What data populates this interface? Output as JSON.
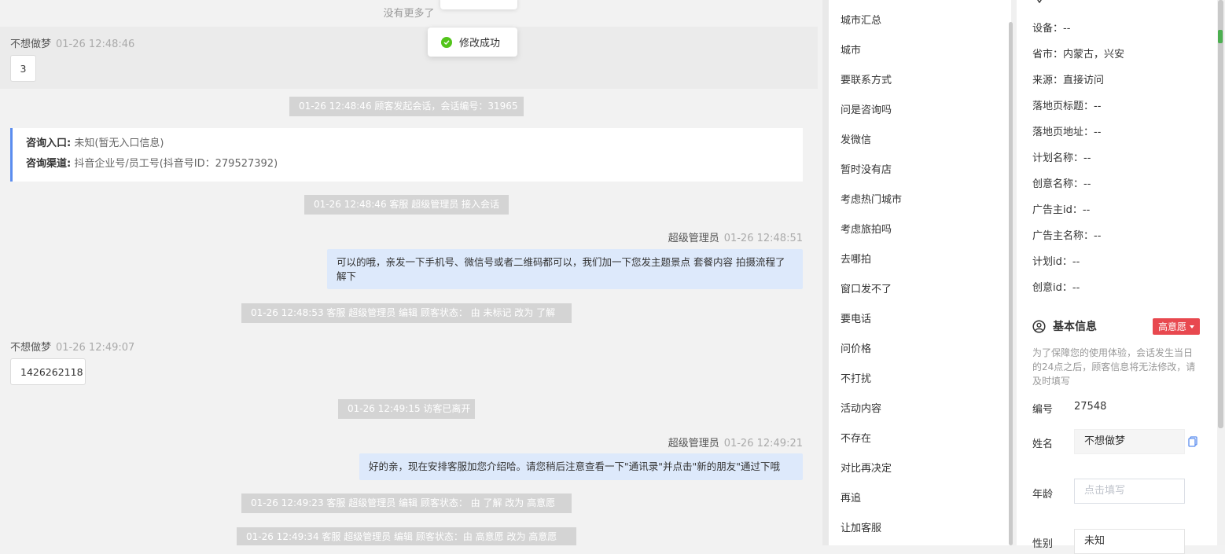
{
  "chat": {
    "no_more": "没有更多了",
    "toast": "修改成功",
    "messages": {
      "m1_sender": "不想做梦",
      "m1_time": "01-26 12:48:46",
      "m1_text": "3",
      "sys1": "01-26 12:48:46 顾客发起会话，会话编号：31965",
      "consult_entry_label": "咨询入口:",
      "consult_entry_value": "未知(暂无入口信息)",
      "consult_channel_label": "咨询渠道:",
      "consult_channel_value": "抖音企业号/员工号(抖音号ID：279527392)",
      "sys2": "01-26 12:48:46 客服 超级管理员 接入会话",
      "m2_sender": "超级管理员",
      "m2_time": "01-26 12:48:51",
      "m2_text": "可以的哦，亲发一下手机号、微信号或者二维码都可以，我们加一下您发主题景点 套餐内容 拍摄流程了解下",
      "sys3": "01-26 12:48:53 客服 超级管理员 编辑 顾客状态： 由 未标记 改为 了解",
      "m3_sender": "不想做梦",
      "m3_time": "01-26 12:49:07",
      "m3_text": "1426262118",
      "sys4": "01-26 12:49:15 访客已离开",
      "m4_sender": "超级管理员",
      "m4_time": "01-26 12:49:21",
      "m4_text": "好的亲，现在安排客服加您介绍哈。请您稍后注意查看一下\"通讯录\"并点击\"新的朋友\"通过下哦",
      "sys5": "01-26 12:49:23 客服 超级管理员 编辑 顾客状态： 由 了解 改为 高意愿",
      "sys6": "01-26 12:49:34 客服 超级管理员 编辑 顾客状态：由 高意愿 改为 高意愿"
    }
  },
  "quick_replies": [
    "城市汇总",
    "城市",
    "要联系方式",
    "问是咨询吗",
    "发微信",
    "暂时没有店",
    "考虑热门城市",
    "考虑旅拍吗",
    "去哪拍",
    "窗口发不了",
    "要电话",
    "问价格",
    "不打扰",
    "活动内容",
    "不存在",
    "对比再决定",
    "再追",
    "让加客服"
  ],
  "info": {
    "rows": [
      {
        "k": "设备：",
        "v": "--"
      },
      {
        "k": "省市：",
        "v": "内蒙古，兴安"
      },
      {
        "k": "来源：",
        "v": "直接访问"
      },
      {
        "k": "落地页标题：",
        "v": "--"
      },
      {
        "k": "落地页地址：",
        "v": "--"
      },
      {
        "k": "计划名称：",
        "v": "--"
      },
      {
        "k": "创意名称：",
        "v": "--"
      },
      {
        "k": "广告主id：",
        "v": "--"
      },
      {
        "k": "广告主名称：",
        "v": "--"
      },
      {
        "k": "计划id：",
        "v": "--"
      },
      {
        "k": "创意id：",
        "v": "--"
      }
    ],
    "basic_title": "基本信息",
    "intent": "高意愿",
    "notice": "为了保障您的使用体验，会话发生当日的24点之后，顾客信息将无法修改，请及时填写",
    "id_label": "编号",
    "id_value": "27548",
    "name_label": "姓名",
    "name_value": "不想做梦",
    "age_label": "年龄",
    "age_placeholder": "点击填写",
    "gender_label": "性别",
    "gender_value": "未知"
  },
  "colors": {
    "accent": "#5b8def",
    "bubble_right": "#dde9fb",
    "system_msg": "#d4d4d4",
    "intent_badge": "#e8484f",
    "success": "#52c41a"
  }
}
